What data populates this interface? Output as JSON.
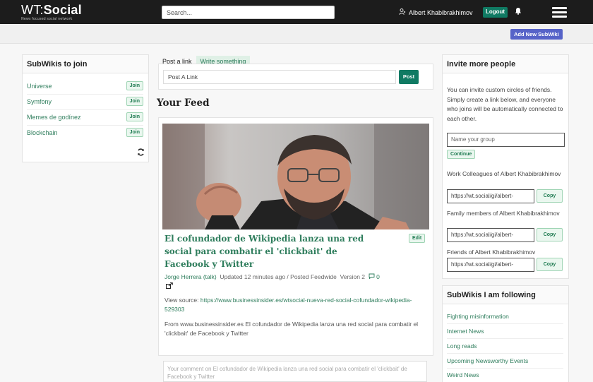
{
  "header": {
    "logo_main_left": "WT:",
    "logo_main_right": "Social",
    "logo_sub": "News focused social network",
    "search_placeholder": "Search...",
    "user_name": "Albert Khabibrakhimov",
    "logout_label": "Logout",
    "add_subwiki_label": "Add New SubWiki"
  },
  "subwikis_to_join": {
    "title": "SubWikis to join",
    "items": [
      {
        "name": "Universe",
        "button": "Join"
      },
      {
        "name": "Symfony",
        "button": "Join"
      },
      {
        "name": "Memes de godínez",
        "button": "Join"
      },
      {
        "name": "Blockchain",
        "button": "Join"
      }
    ]
  },
  "composer": {
    "tab_post_link": "Post a link",
    "tab_write": "Write something",
    "input_placeholder": "Post A Link",
    "post_button": "Post"
  },
  "feed": {
    "title": "Your Feed",
    "article": {
      "title": "El cofundador de Wikipedia lanza una red social para combatir el 'clickbait' de Facebook y Twitter",
      "edit_label": "Edit",
      "author": "Jorge Herrera",
      "talk": "(talk)",
      "updated": "Updated 12 minutes ago",
      "posted": "Posted Feedwide",
      "version": "Version 2",
      "comments_count": "0",
      "view_source_label": "View source:",
      "source_url": "https://www.businessinsider.es/wtsocial-nueva-red-social-cofundador-wikipedia-529303",
      "from_text": "From www.businessinsider.es   El cofundador de Wikipedia lanza una red social para combatir el 'clickbait' de Facebook y Twitter"
    },
    "comment_placeholder": "Your comment on El cofundador de Wikipedia lanza una red social para combatir el 'clickbait' de Facebook y Twitter"
  },
  "invite": {
    "title": "Invite more people",
    "description": "You can invite custom circles of friends. Simply create a link below, and everyone who joins will be automatically connected to each other.",
    "group_placeholder": "Name your group",
    "continue_label": "Continue",
    "circles": [
      {
        "label": "Work Colleagues of Albert Khabibrakhimov",
        "link": "https://wt.social/gi/albert-",
        "copy": "Copy"
      },
      {
        "label": "Family members of Albert Khabibrakhimov",
        "link": "https://wt.social/gi/albert-",
        "copy": "Copy"
      },
      {
        "label": "Friends of Albert Khabibrakhimov",
        "link": "https://wt.social/gi/albert-",
        "copy": "Copy"
      }
    ]
  },
  "following": {
    "title": "SubWikis I am following",
    "items": [
      "Fighting misinformation",
      "Internet News",
      "Long reads",
      "Upcoming Newsworthy Events",
      "Weird News"
    ]
  },
  "colors": {
    "topbar": "#1c1c1c",
    "accent_green": "#107a63",
    "link_green": "#2e7d5c",
    "add_button": "#5663c8"
  }
}
